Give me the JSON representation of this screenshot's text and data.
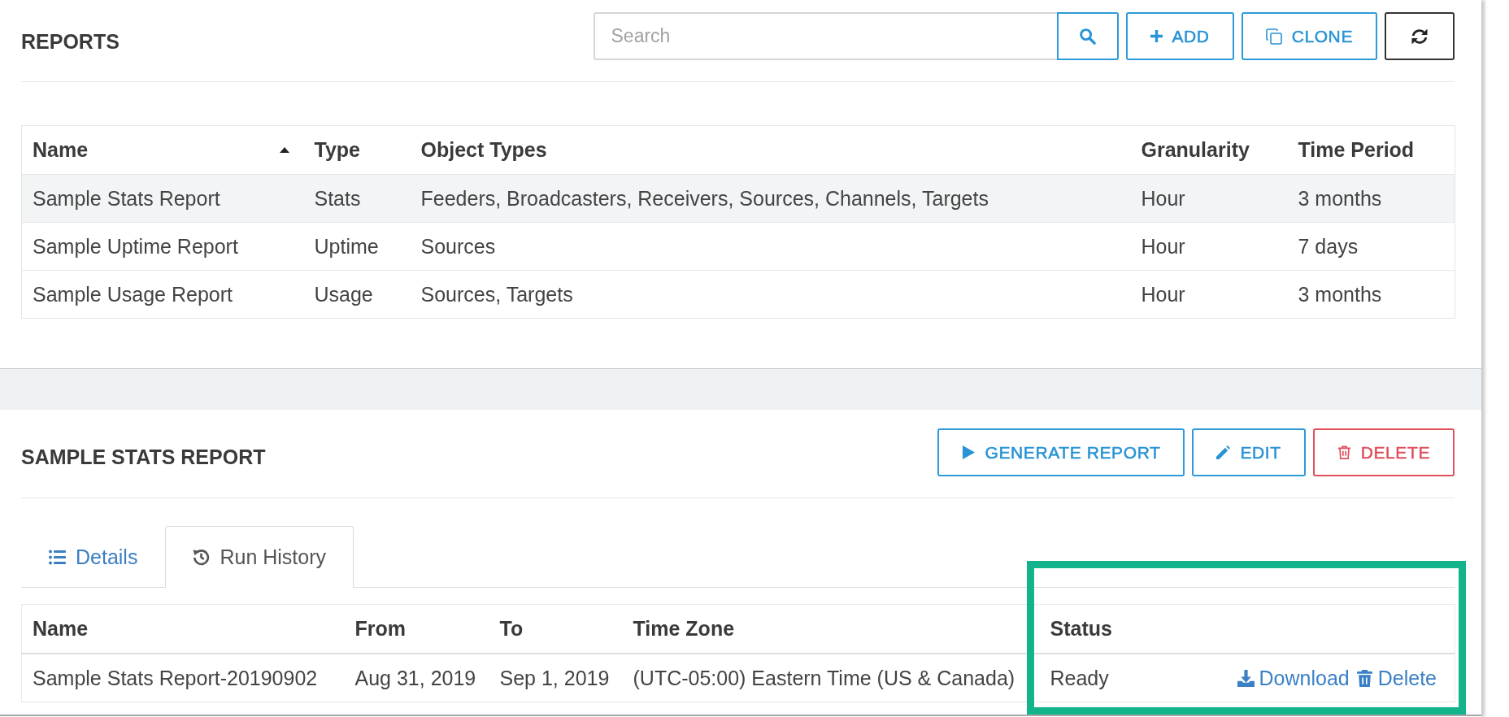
{
  "reports": {
    "title": "REPORTS",
    "search": {
      "placeholder": "Search"
    },
    "buttons": [
      {
        "kind": "search"
      },
      {
        "kind": "add",
        "label": "ADD"
      },
      {
        "kind": "clone",
        "label": "CLONE"
      },
      {
        "kind": "refresh"
      }
    ],
    "table": {
      "columns": [
        {
          "label": "Name",
          "sorted": true
        },
        {
          "label": "Type",
          "sorted": false
        },
        {
          "label": "Object Types",
          "sorted": false
        },
        {
          "label": "Granularity",
          "sorted": false
        },
        {
          "label": "Time Period",
          "sorted": false
        }
      ],
      "rows": [
        {
          "selected": true,
          "cells": [
            "Sample Stats Report",
            "Stats",
            "Feeders, Broadcasters, Receivers, Sources, Channels, Targets",
            "Hour",
            "3 months"
          ]
        },
        {
          "selected": false,
          "cells": [
            "Sample Uptime Report",
            "Uptime",
            "Sources",
            "Hour",
            "7 days"
          ]
        },
        {
          "selected": false,
          "cells": [
            "Sample Usage Report",
            "Usage",
            "Sources, Targets",
            "Hour",
            "3 months"
          ]
        }
      ]
    }
  },
  "report_detail": {
    "title": "SAMPLE STATS REPORT",
    "buttons": [
      {
        "kind": "generate",
        "label": "GENERATE REPORT"
      },
      {
        "kind": "edit",
        "label": "EDIT"
      },
      {
        "kind": "delete",
        "label": "DELETE"
      }
    ],
    "tabs": [
      {
        "kind": "details",
        "label": "Details",
        "selected": false
      },
      {
        "kind": "history",
        "label": "Run History",
        "selected": true
      }
    ],
    "run_history": {
      "status_highlighted": true,
      "columns": [
        "Name",
        "From",
        "To",
        "Time Zone",
        "Status"
      ],
      "rows": [
        {
          "cells": [
            "Sample Stats Report-20190902",
            "Aug 31, 2019",
            "Sep 1, 2019",
            "(UTC-05:00) Eastern Time (US & Canada)",
            "Ready"
          ],
          "actions": [
            {
              "kind": "download",
              "label": "Download"
            },
            {
              "kind": "delete",
              "label": "Delete"
            }
          ]
        }
      ]
    }
  }
}
